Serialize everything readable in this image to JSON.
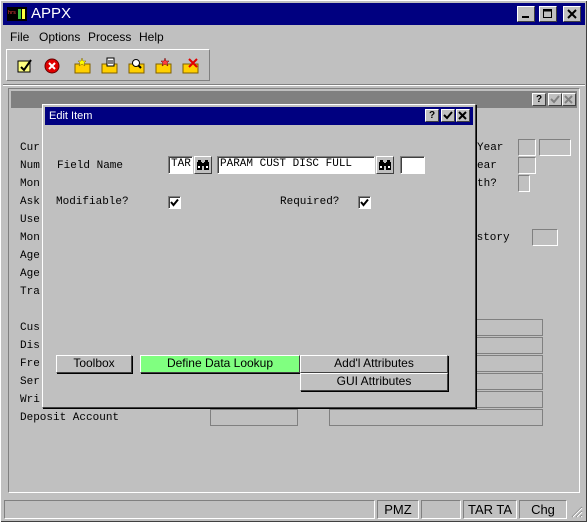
{
  "app": {
    "title": "APPX"
  },
  "menu": [
    "File",
    "Options",
    "Process",
    "Help"
  ],
  "toolbar_icons": [
    "check-doc-icon",
    "cancel-icon",
    "folder-star-icon",
    "folder-edit-icon",
    "folder-search-icon",
    "folder-star2-icon",
    "folder-delete-icon"
  ],
  "background": {
    "labels_left": [
      "Cur",
      "Num",
      "Mon",
      "Ask",
      "Use",
      "Mon",
      "Age",
      "Age",
      "Tra",
      "Cus",
      "Dis",
      "Fre",
      "Ser",
      "Wri",
      "Deposit Account"
    ],
    "labels_right": [
      "Year",
      "ear",
      "th?",
      "istory"
    ]
  },
  "dialog": {
    "title": "Edit Item",
    "field_name_label": "Field Name",
    "field_prefix": "TAR",
    "field_value": "PARAM CUST DISC FULL",
    "field_suffix": "",
    "modifiable_label": "Modifiable?",
    "modifiable_checked": true,
    "required_label": "Required?",
    "required_checked": true,
    "buttons": {
      "toolbox": "Toolbox",
      "define_lookup": "Define Data Lookup",
      "addl_attributes": "Add'l Attributes",
      "gui_attributes": "GUI Attributes"
    },
    "define_lookup_color": "#80ff80"
  },
  "status": {
    "cells": [
      "",
      "PMZ",
      "",
      "TAR TA",
      "Chg"
    ]
  }
}
